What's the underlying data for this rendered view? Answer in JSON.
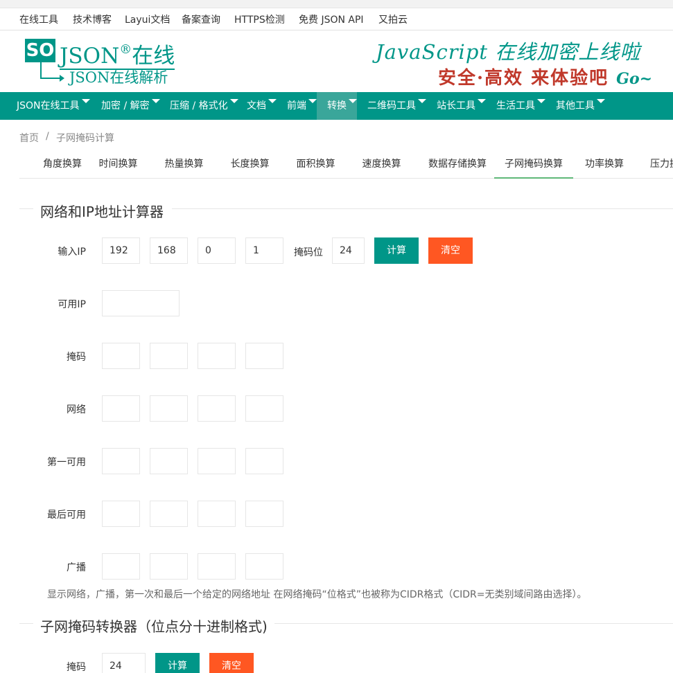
{
  "top_links": [
    "在线工具",
    "技术博客",
    "Layui文档",
    "备案查询",
    "HTTPS检测",
    "免费 JSON API",
    "又拍云"
  ],
  "logo": {
    "box": "SO",
    "main": "JSON",
    "reg": "®",
    "suffix": "在线",
    "sub": "JSON在线解析"
  },
  "banner": {
    "line1": "JavaScript 在线加密上线啦",
    "line2": "安全·高效 来体验吧",
    "line2_tail": "Go~"
  },
  "nav": [
    {
      "label": "JSON在线工具",
      "caret": true
    },
    {
      "label": "加密 / 解密",
      "caret": true
    },
    {
      "label": "压缩 / 格式化",
      "caret": true
    },
    {
      "label": "文档",
      "caret": true
    },
    {
      "label": "前端",
      "caret": true
    },
    {
      "label": "转换",
      "caret": true,
      "active": true
    },
    {
      "label": "二维码工具",
      "caret": true
    },
    {
      "label": "站长工具",
      "caret": true
    },
    {
      "label": "生活工具",
      "caret": true
    },
    {
      "label": "其他工具",
      "caret": true
    }
  ],
  "breadcrumb": {
    "home": "首页",
    "sep": "/",
    "current": "子网掩码计算"
  },
  "tabs": [
    "角度换算",
    "时间换算",
    "热量换算",
    "长度换算",
    "面积换算",
    "速度换算",
    "数据存储换算",
    "子网掩码换算",
    "功率换算",
    "压力换"
  ],
  "section1": {
    "title": "网络和IP地址计算器",
    "input_ip_label": "输入IP",
    "ip": [
      "192",
      "168",
      "0",
      "1"
    ],
    "mask_bits_label": "掩码位",
    "mask_bits": "24",
    "calc_label": "计算",
    "clear_label": "清空",
    "usable_ip_label": "可用IP",
    "mask_label": "掩码",
    "network_label": "网络",
    "first_label": "第一可用",
    "last_label": "最后可用",
    "broadcast_label": "广播",
    "note": "显示网络，广播，第一次和最后一个给定的网络地址 在网络掩码“位格式”也被称为CIDR格式（CIDR=无类别域间路由选择）。"
  },
  "section2": {
    "title": "子网掩码转换器（位点分十进制格式)",
    "mask_label": "掩码",
    "mask_value": "24",
    "calc_label": "计算",
    "clear_label": "清空"
  },
  "colors": {
    "primary": "#009688",
    "danger": "#ff5722",
    "nav_active": "#3aa69a",
    "tab_active": "#5fb878"
  }
}
